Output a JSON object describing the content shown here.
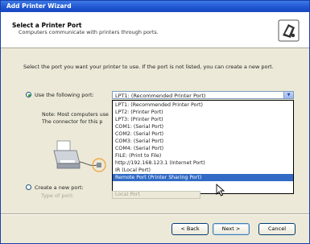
{
  "window": {
    "title": "Add Printer Wizard"
  },
  "header": {
    "title": "Select a Printer Port",
    "subtitle": "Computers communicate with printers through ports.",
    "icon": "printer-wizard-icon"
  },
  "instructions": "Select the port you want your printer to use. If the port is not listed, you can create a new port.",
  "use_port": {
    "label": "Use the following port:",
    "selected": true,
    "value": "LPT1: (Recommended Printer Port)"
  },
  "port_list": {
    "items": [
      "LPT1: (Recommended Printer Port)",
      "LPT2: (Printer Port)",
      "LPT3: (Printer Port)",
      "COM1: (Serial Port)",
      "COM2: (Serial Port)",
      "COM3: (Serial Port)",
      "COM4: (Serial Port)",
      "FILE: (Print to File)",
      "http://192.168.123.1 (Internet Port)",
      "IR (Local Port)",
      "Remote Port (Printer Sharing Port)"
    ],
    "highlighted": "Remote Port (Printer Sharing Port)"
  },
  "note": {
    "line1": "Note: Most computers use",
    "line2": "The connector for this p"
  },
  "create_port": {
    "label": "Create a new port:",
    "selected": false,
    "type_label": "Type of port:",
    "type_value": "Local Port"
  },
  "buttons": {
    "back": "< Back",
    "next": "Next >",
    "cancel": "Cancel"
  },
  "colors": {
    "titlebar": "#1f54d0",
    "selection": "#316ac5",
    "dialog_bg": "#ece9d8"
  }
}
